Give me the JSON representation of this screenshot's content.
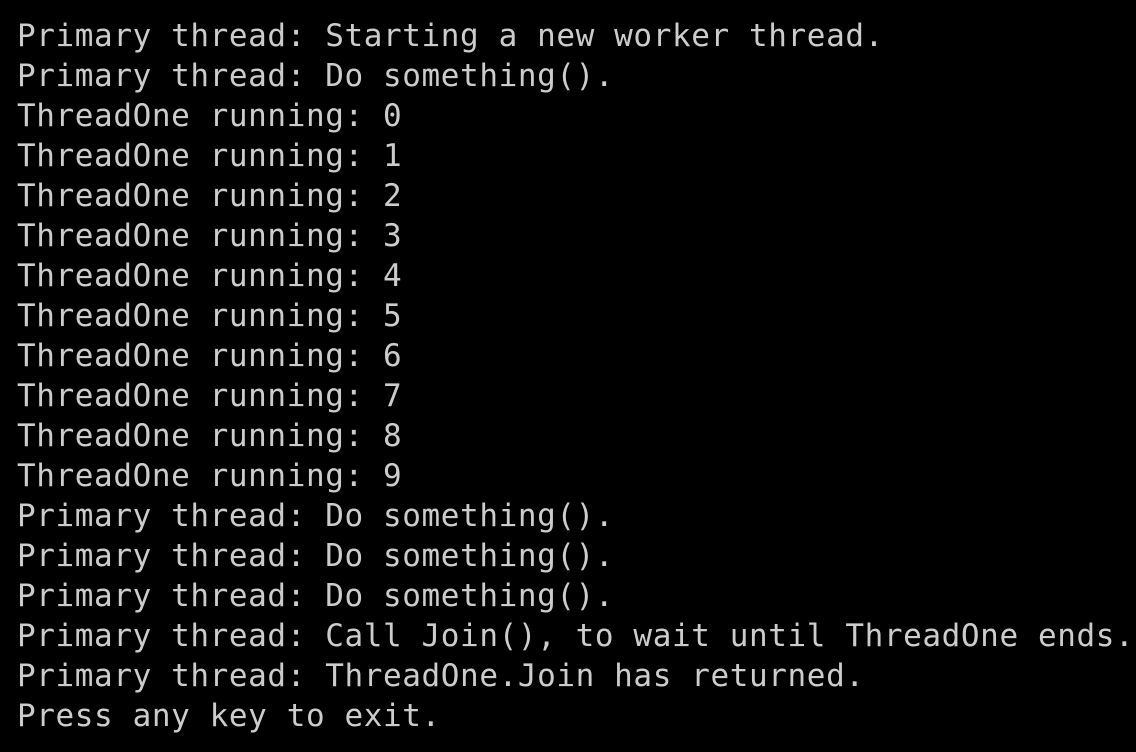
{
  "console": {
    "lines": [
      "Primary thread: Starting a new worker thread.",
      "Primary thread: Do something().",
      "ThreadOne running: 0",
      "ThreadOne running: 1",
      "ThreadOne running: 2",
      "ThreadOne running: 3",
      "ThreadOne running: 4",
      "ThreadOne running: 5",
      "ThreadOne running: 6",
      "ThreadOne running: 7",
      "ThreadOne running: 8",
      "ThreadOne running: 9",
      "Primary thread: Do something().",
      "Primary thread: Do something().",
      "Primary thread: Do something().",
      "Primary thread: Call Join(), to wait until ThreadOne ends.",
      "Primary thread: ThreadOne.Join has returned.",
      "Press any key to exit."
    ],
    "colors": {
      "background": "#000000",
      "text": "#cccccc"
    }
  }
}
